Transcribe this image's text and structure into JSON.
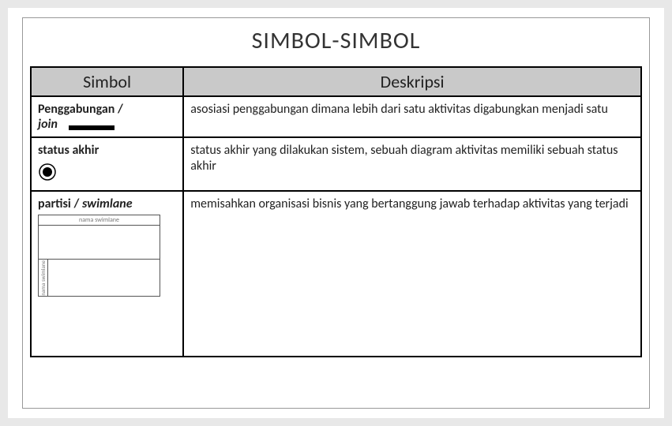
{
  "title": "SIMBOL-SIMBOL",
  "headers": {
    "simbol": "Simbol",
    "deskripsi": "Deskripsi"
  },
  "rows": [
    {
      "sym_main": "Penggabungan /",
      "sym_sub": "join",
      "desc": "asosiasi penggabungan dimana lebih dari satu aktivitas digabungkan menjadi satu"
    },
    {
      "sym_main": "status akhir",
      "desc": "status akhir yang dilakukan sistem,  sebuah diagram aktivitas memiliki sebuah status akhir"
    },
    {
      "sym_main": "partisi / ",
      "sym_sub": "swimlane",
      "desc": "memisahkan organisasi bisnis yang bertanggung jawab terhadap aktivitas yang terjadi",
      "fig_label_h": "nama swimlane",
      "fig_label_v": "nama swimlane"
    }
  ]
}
